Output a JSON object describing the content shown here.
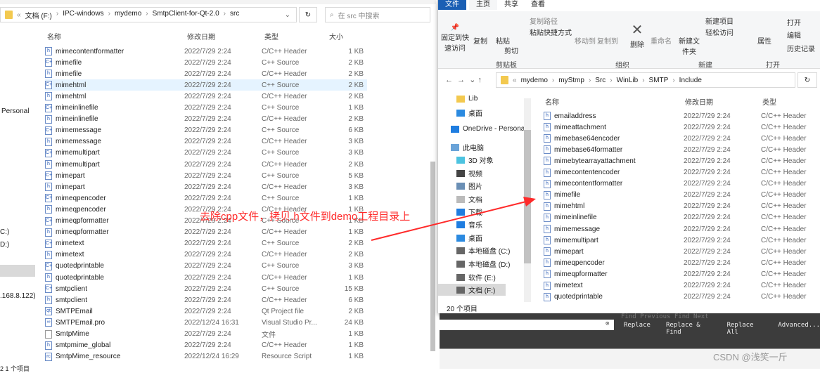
{
  "left": {
    "breadcrumb": [
      "文档 (F:)",
      "IPC-windows",
      "mydemo",
      "SmtpClient-for-Qt-2.0",
      "src"
    ],
    "search_placeholder": "在 src 中搜索",
    "columns": {
      "name": "名称",
      "date": "修改日期",
      "type": "类型",
      "size": "大小"
    },
    "sidebar": [
      "Personal",
      "C:)",
      "D:)",
      ".168.8.122)"
    ],
    "status": "2 1 个项目",
    "rows": [
      {
        "name": "mimecontentformatter",
        "icon": "h",
        "date": "2022/7/29 2:24",
        "type": "C/C++ Header",
        "size": "1 KB"
      },
      {
        "name": "mimefile",
        "icon": "cpp",
        "date": "2022/7/29 2:24",
        "type": "C++ Source",
        "size": "2 KB"
      },
      {
        "name": "mimefile",
        "icon": "h",
        "date": "2022/7/29 2:24",
        "type": "C/C++ Header",
        "size": "2 KB"
      },
      {
        "name": "mimehtml",
        "icon": "cpp",
        "date": "2022/7/29 2:24",
        "type": "C++ Source",
        "size": "2 KB",
        "selected": true
      },
      {
        "name": "mimehtml",
        "icon": "h",
        "date": "2022/7/29 2:24",
        "type": "C/C++ Header",
        "size": "2 KB"
      },
      {
        "name": "mimeinlinefile",
        "icon": "cpp",
        "date": "2022/7/29 2:24",
        "type": "C++ Source",
        "size": "1 KB"
      },
      {
        "name": "mimeinlinefile",
        "icon": "h",
        "date": "2022/7/29 2:24",
        "type": "C/C++ Header",
        "size": "2 KB"
      },
      {
        "name": "mimemessage",
        "icon": "cpp",
        "date": "2022/7/29 2:24",
        "type": "C++ Source",
        "size": "6 KB"
      },
      {
        "name": "mimemessage",
        "icon": "h",
        "date": "2022/7/29 2:24",
        "type": "C/C++ Header",
        "size": "3 KB"
      },
      {
        "name": "mimemultipart",
        "icon": "cpp",
        "date": "2022/7/29 2:24",
        "type": "C++ Source",
        "size": "3 KB"
      },
      {
        "name": "mimemultipart",
        "icon": "h",
        "date": "2022/7/29 2:24",
        "type": "C/C++ Header",
        "size": "2 KB"
      },
      {
        "name": "mimepart",
        "icon": "cpp",
        "date": "2022/7/29 2:24",
        "type": "C++ Source",
        "size": "5 KB"
      },
      {
        "name": "mimepart",
        "icon": "h",
        "date": "2022/7/29 2:24",
        "type": "C/C++ Header",
        "size": "3 KB"
      },
      {
        "name": "mimeqpencoder",
        "icon": "cpp",
        "date": "2022/7/29 2:24",
        "type": "C++ Source",
        "size": "1 KB"
      },
      {
        "name": "mimeqpencoder",
        "icon": "h",
        "date": "2022/7/29 2:24",
        "type": "C/C++ Header",
        "size": "1 KB"
      },
      {
        "name": "mimeqpformatter",
        "icon": "cpp",
        "date": "2022/7/29 2:24",
        "type": "C++ Source",
        "size": "1 KB"
      },
      {
        "name": "mimeqpformatter",
        "icon": "h",
        "date": "2022/7/29 2:24",
        "type": "C/C++ Header",
        "size": "1 KB"
      },
      {
        "name": "mimetext",
        "icon": "cpp",
        "date": "2022/7/29 2:24",
        "type": "C++ Source",
        "size": "2 KB"
      },
      {
        "name": "mimetext",
        "icon": "h",
        "date": "2022/7/29 2:24",
        "type": "C/C++ Header",
        "size": "2 KB"
      },
      {
        "name": "quotedprintable",
        "icon": "cpp",
        "date": "2022/7/29 2:24",
        "type": "C++ Source",
        "size": "3 KB"
      },
      {
        "name": "quotedprintable",
        "icon": "h",
        "date": "2022/7/29 2:24",
        "type": "C/C++ Header",
        "size": "1 KB"
      },
      {
        "name": "smtpclient",
        "icon": "cpp",
        "date": "2022/7/29 2:24",
        "type": "C++ Source",
        "size": "15 KB"
      },
      {
        "name": "smtpclient",
        "icon": "h",
        "date": "2022/7/29 2:24",
        "type": "C/C++ Header",
        "size": "6 KB"
      },
      {
        "name": "SMTPEmail",
        "icon": "qt",
        "date": "2022/7/29 2:24",
        "type": "Qt Project file",
        "size": "2 KB"
      },
      {
        "name": "SMTPEmail.pro",
        "icon": "vs",
        "date": "2022/12/24 16:31",
        "type": "Visual Studio Pr...",
        "size": "24 KB"
      },
      {
        "name": "SmtpMime",
        "icon": "file",
        "date": "2022/7/29 2:24",
        "type": "文件",
        "size": "1 KB"
      },
      {
        "name": "smtpmime_global",
        "icon": "h",
        "date": "2022/7/29 2:24",
        "type": "C/C++ Header",
        "size": "1 KB"
      },
      {
        "name": "SmtpMime_resource",
        "icon": "rc",
        "date": "2022/12/24 16:29",
        "type": "Resource Script",
        "size": "1 KB"
      }
    ]
  },
  "right": {
    "tabs": [
      "文件",
      "主页",
      "共享",
      "查看"
    ],
    "ribbon": {
      "pin": "固定到快速访问",
      "copy": "复制",
      "paste": "粘贴",
      "copy_path": "复制路径",
      "paste_shortcut": "粘贴快捷方式",
      "cut": "剪切",
      "g1": "剪贴板",
      "move_to": "移动到",
      "copy_to": "复制到",
      "delete": "删除",
      "rename": "重命名",
      "g2": "组织",
      "new_folder": "新建文件夹",
      "new_item": "新建项目",
      "easy_access": "轻松访问",
      "g3": "新建",
      "properties": "属性",
      "open": "打开",
      "edit": "编辑",
      "history": "历史记录",
      "g4": "打开"
    },
    "breadcrumb": [
      "mydemo",
      "myStmp",
      "Src",
      "WinLib",
      "SMTP",
      "Include"
    ],
    "nav": [
      "Lib",
      "桌面",
      "OneDrive - Persona",
      "此电脑",
      "3D 对象",
      "视频",
      "图片",
      "文档",
      "下载",
      "音乐",
      "桌面",
      "本地磁盘 (C:)",
      "本地磁盘 (D:)",
      "软件 (E:)",
      "文档 (F:)"
    ],
    "columns": {
      "name": "名称",
      "date": "修改日期",
      "type": "类型"
    },
    "rows": [
      "emailaddress",
      "mimeattachment",
      "mimebase64encoder",
      "mimebase64formatter",
      "mimebytearrayattachment",
      "mimecontentencoder",
      "mimecontentformatter",
      "mimefile",
      "mimehtml",
      "mimeinlinefile",
      "mimemessage",
      "mimemultipart",
      "mimepart",
      "mimeqpencoder",
      "mimeqpformatter",
      "mimetext",
      "quotedprintable"
    ],
    "row_date": "2022/7/29 2:24",
    "row_type": "C/C++ Header",
    "status": "20 个项目"
  },
  "editor": {
    "buttons": [
      "Replace",
      "Replace & Find",
      "Replace All",
      "Advanced..."
    ],
    "faded": "Find Previous   Find Next"
  },
  "annotation": "去除cpp文件，拷贝.h文件到demo工程目录上",
  "watermark": "CSDN @浅笑一斤",
  "colors": {
    "annotation": "#ff2a2a",
    "selected": "#e5f3ff",
    "ribbon_file_tab": "#1a5fb4"
  }
}
